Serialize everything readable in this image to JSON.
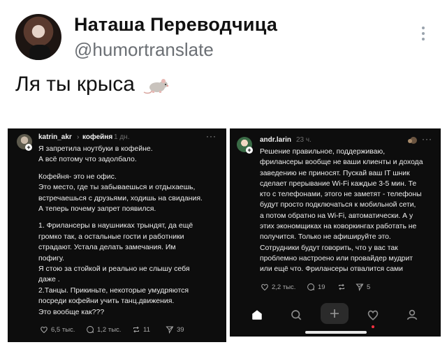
{
  "tweet": {
    "display_name": "Наташа Переводчица",
    "handle": "@humortranslate",
    "text": "Ля ты крыса",
    "emoji_icon": "rat-icon"
  },
  "left_post": {
    "author": "katrin_akr",
    "reply_to": "кофейня",
    "time": "1 дн.",
    "paragraphs": [
      [
        "Я запретила ноутбуки в кофейне.",
        "А  всё потому что задолбало."
      ],
      [
        "Кофейня- это не офис.",
        "Это место, где ты забываешься и отдыхаешь,",
        "встречаешься с друзьями, ходишь на свидания.",
        "А теперь  почему запрет появился."
      ],
      [
        "1. Фрилансеры в наушниках трындят, да ещё",
        "громко так, а остальные гости и работники",
        "страдают. Устала делать замечания. Им",
        "пофигу.",
        "Я стою за стойкой и реально не слышу себя",
        "даже .",
        "2.Танцы. Прикиньте, некоторые умудряются",
        "посреди кофейни учить танц.движения.",
        "Это вообще как???"
      ]
    ],
    "likes": "6,5 тыс.",
    "replies": "1,2 тыс.",
    "reposts": "11",
    "shares": "39"
  },
  "right_post": {
    "author": "andr.larin",
    "time": "23 ч.",
    "lines": [
      "Решение правильное, поддерживаю,",
      "фрилансеры вообще не ваши клиенты и дохода",
      "заведению не приносят. Пускай ваш IT шник",
      "сделает прерывание Wi-Fi каждые 3-5 мин. Те",
      "кто с телефонами, этого не заметят - телефоны",
      "будут просто подключаться к мобильной сети,",
      "а потом обратно на Wi-Fi, автоматически. А у",
      "этих экономщиках на коворкингах работать не",
      "получится. Только не афишируйте это.",
      "Сотрудники будут говорить, что у вас так",
      "проблемно настроено или провайдер мудрит",
      "или ещё что. Фрилансеры отвалится сами"
    ],
    "likes": "2,2 тыс.",
    "replies": "19",
    "reposts": "",
    "shares": "5"
  },
  "nav": {
    "items": [
      "home-icon",
      "search-icon",
      "compose-icon",
      "heart-icon",
      "profile-icon"
    ],
    "notification_color": "#ff3040"
  },
  "colors": {
    "panel_bg": "#0d0d0d",
    "handle": "#6b6f74"
  }
}
